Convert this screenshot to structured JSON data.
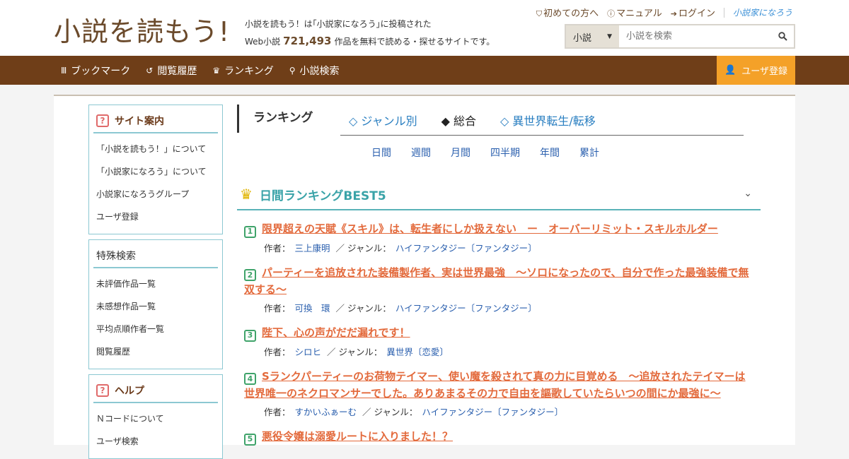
{
  "header": {
    "logo": "小説を読もう!",
    "tagline_line1": "小説を読もう！は｢小説家になろう｣に投稿された",
    "tagline_prefix": "Web小説",
    "novel_count": "721,493",
    "tagline_suffix": "作品を無料で読める・探せるサイトです。",
    "links": {
      "first_time": "初めての方へ",
      "manual": "マニュアル",
      "login": "ログイン",
      "narou_logo": "小説家になろう"
    },
    "search": {
      "category": "小説",
      "placeholder": "小説を検索"
    }
  },
  "nav": {
    "items": [
      {
        "label": "ブックマーク",
        "icon": "bookmark-icon"
      },
      {
        "label": "閲覧履歴",
        "icon": "history-icon"
      },
      {
        "label": "ランキング",
        "icon": "crown-icon"
      },
      {
        "label": "小説検索",
        "icon": "search-icon"
      }
    ],
    "register": "ユーザ登録"
  },
  "sidebar": {
    "guide": {
      "title": "サイト案内",
      "items": [
        "「小説を読もう！」について",
        "「小説家になろう」について",
        "小説家になろうグループ",
        "ユーザ登録"
      ]
    },
    "special": {
      "title": "特殊検索",
      "items": [
        "未評価作品一覧",
        "未感想作品一覧",
        "平均点順作者一覧",
        "閲覧履歴"
      ]
    },
    "help": {
      "title": "ヘルプ",
      "items": [
        "Ｎコードについて",
        "ユーザ検索"
      ]
    }
  },
  "main": {
    "ranking_title": "ランキング",
    "tabs": [
      "◇ ジャンル別",
      "◆ 総合",
      "◇ 異世界転生/転移"
    ],
    "periods": [
      "日間",
      "週間",
      "月間",
      "四半期",
      "年間",
      "累計"
    ],
    "best_title": "日間ランキングBEST5",
    "author_label": "作者：",
    "genre_label": "／ ジャンル：",
    "rankings": [
      {
        "num": "1",
        "title": "限界超えの天賦《スキル》は、転生者にしか扱えない　ー　オーバーリミット・スキルホルダー",
        "author": "三上康明",
        "genre": "ハイファンタジー〔ファンタジー〕"
      },
      {
        "num": "2",
        "title": "パーティーを追放された装備製作者、実は世界最強　〜ソロになったので、自分で作った最強装備で無双する〜",
        "author": "可換　環",
        "genre": "ハイファンタジー〔ファンタジー〕"
      },
      {
        "num": "3",
        "title": "陛下、心の声がだだ漏れです！",
        "author": "シロヒ",
        "genre": "異世界〔恋愛〕"
      },
      {
        "num": "4",
        "title": "Sランクパーティーのお荷物テイマー、使い魔を殺されて真の力に目覚める　〜追放されたテイマーは世界唯一のネクロマンサーでした。ありあまるその力で自由を謳歌していたらいつの間にか最強に〜",
        "author": "すかいふぁーむ",
        "genre": "ハイファンタジー〔ファンタジー〕"
      },
      {
        "num": "5",
        "title": "悪役令嬢は溺愛ルートに入りました！？",
        "author": "",
        "genre": ""
      }
    ]
  }
}
